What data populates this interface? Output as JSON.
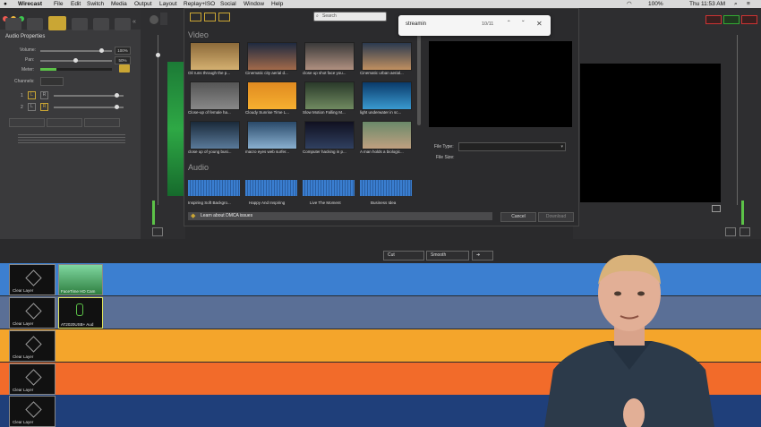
{
  "menubar": {
    "app_name": "Wirecast",
    "items": [
      "File",
      "Edit",
      "Switch",
      "Media",
      "Output",
      "Layout",
      "Replay+ISO",
      "Social",
      "Window",
      "Help"
    ],
    "battery": "100%",
    "clock": "Thu 11:53 AM"
  },
  "audio_properties": {
    "title": "Audio Properties",
    "volume_label": "Volume:",
    "volume_value": "100%",
    "pan_label": "Pan:",
    "pan_value": "50%",
    "meter_label": "Meter:",
    "channels_label": "Channels:",
    "l_label": "L",
    "r_label": "R"
  },
  "dialog": {
    "search_placeholder": "Search",
    "video_section": "Video",
    "audio_section": "Audio",
    "video_items": [
      "Oil runs through the p...",
      "Cinematic city aerial d...",
      "close up shot face you...",
      "Cinematic urban aerial...",
      "Close-up of female ha...",
      "Cloudy Sunrise Time L...",
      "Slow Motion Falling M...",
      "light underwater in sc...",
      "close up of young busi...",
      "macro eyes web surfer...",
      "Computer hacking in p...",
      "A man holds a biologic..."
    ],
    "audio_items": [
      "Inspiring Soft Backgro...",
      "Happy And Inspiring",
      "Live The Moment",
      "Business Idea"
    ],
    "dmca_link": "Learn about DMCA issues",
    "file_type_label": "File Type:",
    "file_size_label": "File Size:",
    "cancel_label": "Cancel",
    "download_label": "Download"
  },
  "findbar": {
    "query": "streamin",
    "count": "10/11"
  },
  "transition": {
    "cut_label": "Cut",
    "smooth_label": "Smooth"
  },
  "layers": {
    "clear_label": "Clear Layer",
    "shot1_label": "FaceTime HD Cam",
    "shot2_label": "AT2020USB+ Aud",
    "colors": [
      "#3c7fd0",
      "#5a6f96",
      "#f4a52b",
      "#f26b2a",
      "#1f3f7a"
    ]
  }
}
